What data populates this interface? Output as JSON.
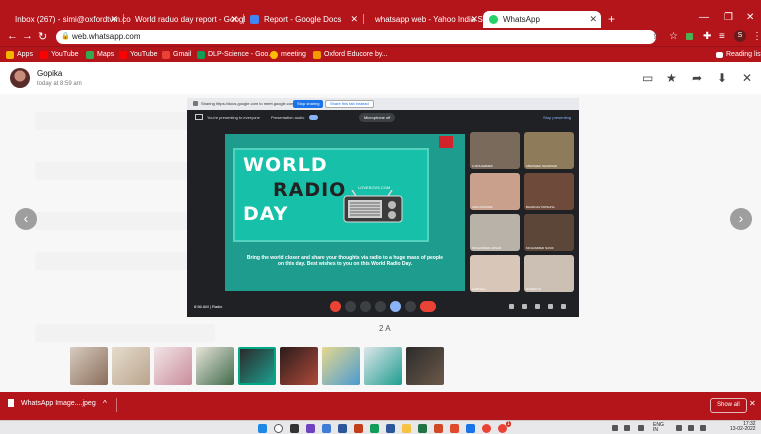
{
  "browser": {
    "tabs": [
      {
        "label": "Inbox (267) - simi@oxfordtvm.co",
        "color": "#ea4335"
      },
      {
        "label": "World raduo day report - Googl",
        "color": "#34a853"
      },
      {
        "label": "Report - Google Docs",
        "color": "#4285f4"
      },
      {
        "label": "whatsapp web - Yahoo India Sea",
        "color": "#6001d2"
      },
      {
        "label": "WhatsApp",
        "color": "#25d366"
      }
    ],
    "new_tab": "+",
    "url": "web.whatsapp.com",
    "profile_initial": "S",
    "bookmarks": [
      {
        "label": "Apps",
        "color": "#f4b400"
      },
      {
        "label": "YouTube",
        "color": "#ff0000"
      },
      {
        "label": "Maps",
        "color": "#34a853"
      },
      {
        "label": "YouTube",
        "color": "#ff0000"
      },
      {
        "label": "Gmail",
        "color": "#ea4335"
      },
      {
        "label": "DLP-Science - Goo...",
        "color": "#0f9d58"
      },
      {
        "label": "meeting",
        "color": "#fbbc05"
      },
      {
        "label": "Oxford Educore by...",
        "color": "#f29900"
      }
    ],
    "reading_list": "Reading list"
  },
  "viewer": {
    "sender": "Gopika",
    "time": "today at 8:59 am",
    "caption": "2 A"
  },
  "meet": {
    "share_text": "Sharing https://docs.google.com to meet.google.com",
    "stop_sharing": "Stop sharing",
    "share_this_tab": "Share this tab instead",
    "presenting": "You're presenting to everyone",
    "presentation_audio": "Presentation audio",
    "microphone_off": "Microphone off",
    "stop_presenting": "Stop presenting",
    "time_label": "8:56 AM  |  Radio",
    "slide": {
      "title_line1": "WORLD",
      "title_line2": "RADIO",
      "title_line3": "DAY",
      "site": "LOVESOVS.COM",
      "message": "Bring the world closer and share your thoughts via radio to a huge mass of people on this day. Best wishes to you on this World Radio Day."
    },
    "participants": [
      {
        "name": "A MOHAMMED"
      },
      {
        "name": "ABHISHEK SHAMNAD"
      },
      {
        "name": "ANIA FATHIMA"
      },
      {
        "name": "BHARGAV KRISHNA"
      },
      {
        "name": "MOHAMMED ANSAR"
      },
      {
        "name": "MOHAMMED NASIF"
      },
      {
        "name": "HARISHA"
      },
      {
        "name": "NIVEDHYA"
      }
    ]
  },
  "download": {
    "file": "WhatsApp Image....jpeg",
    "more": "^",
    "show_all": "Show all",
    "close": "✕"
  },
  "taskbar": {
    "lang_line1": "ENG",
    "lang_line2": "IN",
    "clock_time": "17:32",
    "clock_date": "13-02-2022",
    "notification_count": "1"
  }
}
